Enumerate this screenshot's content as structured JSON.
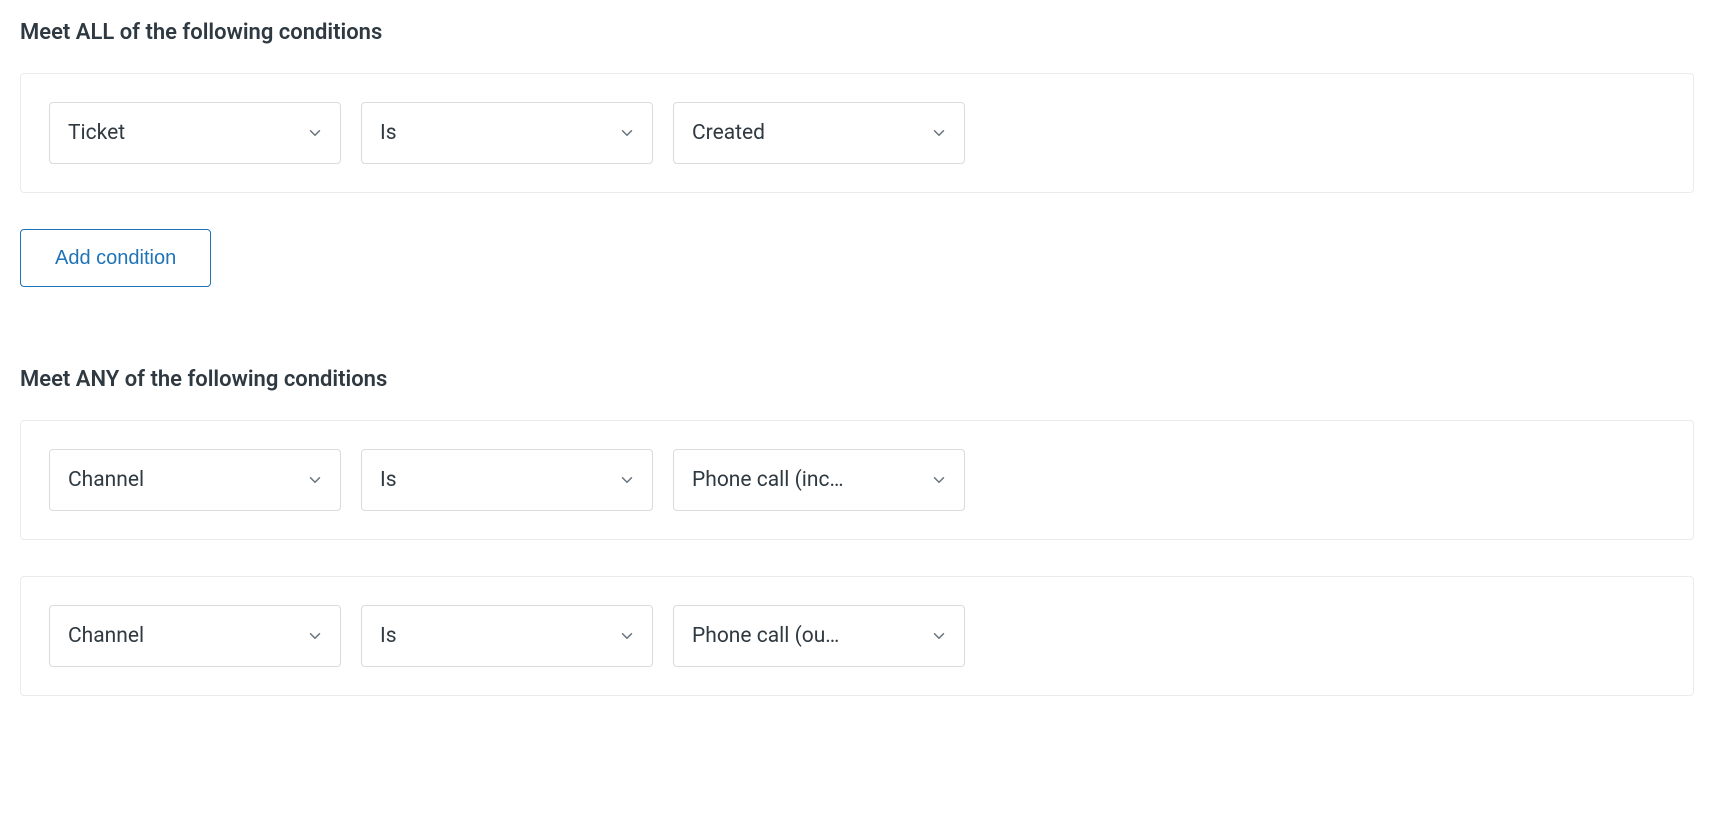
{
  "sections": {
    "all": {
      "title": "Meet ALL of the following conditions",
      "conditions": [
        {
          "field": "Ticket",
          "operator": "Is",
          "value": "Created"
        }
      ],
      "add_label": "Add condition"
    },
    "any": {
      "title": "Meet ANY of the following conditions",
      "conditions": [
        {
          "field": "Channel",
          "operator": "Is",
          "value": "Phone call (inc…"
        },
        {
          "field": "Channel",
          "operator": "Is",
          "value": "Phone call (ou…"
        }
      ]
    }
  }
}
